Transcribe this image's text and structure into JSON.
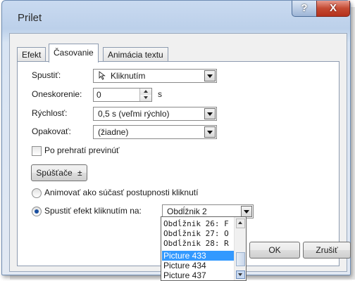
{
  "dialog": {
    "title": "Prilet",
    "help_label": "?",
    "close_label": "X"
  },
  "tabs": [
    {
      "label": "Efekt"
    },
    {
      "label": "Časovanie"
    },
    {
      "label": "Animácia textu"
    }
  ],
  "form": {
    "start_label": "Spustiť:",
    "start_value": "Kliknutím",
    "delay_label": "Oneskorenie:",
    "delay_value": "0",
    "delay_unit": "s",
    "speed_label": "Rýchlosť:",
    "speed_value": "0,5 s (veľmi rýchlo)",
    "repeat_label": "Opakovať:",
    "repeat_value": "(žiadne)",
    "rewind_label": "Po prehratí previnúť",
    "triggers_button": "Spúšťače",
    "triggers_arrow": "±",
    "animate_as_part_label": "Animovať ako súčasť postupnosti kliknutí",
    "start_on_click_label": "Spustiť efekt kliknutím na:",
    "start_on_click_value": "Obdĺžnik 2"
  },
  "dropdown_items": [
    {
      "label": "Obdĺžnik 26: F"
    },
    {
      "label": "Obdĺžnik 27: O"
    },
    {
      "label": "Obdĺžnik 28: R"
    },
    {
      "label": "Picture 433"
    },
    {
      "label": "Picture 434"
    },
    {
      "label": "Picture 437"
    }
  ],
  "selected_dropdown_item": "Picture 433",
  "footer": {
    "ok_label": "OK",
    "cancel_label": "Zrušiť"
  },
  "colors": {
    "selection": "#3399ff",
    "close_button": "#c44a32"
  }
}
